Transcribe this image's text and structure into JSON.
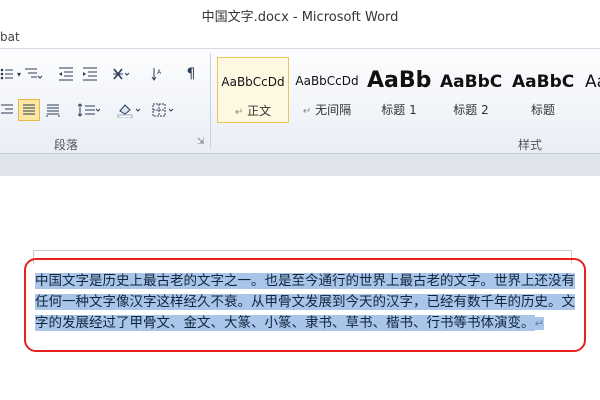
{
  "window": {
    "title": "中国文字.docx - Microsoft Word"
  },
  "tabs": {
    "partial_label": "bat"
  },
  "ribbon": {
    "paragraph_group_label": "段落",
    "styles_group_label": "样式",
    "styles": [
      {
        "preview": "AaBbCcDd",
        "name": "正文",
        "active": true
      },
      {
        "preview": "AaBbCcDd",
        "name": "无间隔",
        "active": false
      },
      {
        "preview": "AaBb",
        "name": "标题 1",
        "active": false
      },
      {
        "preview": "AaBbC",
        "name": "标题 2",
        "active": false
      },
      {
        "preview": "AaBbC",
        "name": "标题",
        "active": false
      },
      {
        "preview": "Aa",
        "name": "",
        "active": false
      }
    ],
    "paragraph_mark": "↵"
  },
  "document": {
    "paragraph": "中国文字是历史上最古老的文字之一。也是至今通行的世界上最古老的文字。世界上还没有任何一种文字像汉字这样经久不衰。从甲骨文发展到今天的汉字，已经有数千年的历史。文字的发展经过了甲骨文、金文、大篆、小篆、隶书、草书、楷书、行书等书体演变。",
    "paragraph_end_mark": "↵",
    "selected": true
  },
  "colors": {
    "selection": "#a9c6ea",
    "annotation_box": "#e52121",
    "active_style_border": "#eec35a"
  }
}
